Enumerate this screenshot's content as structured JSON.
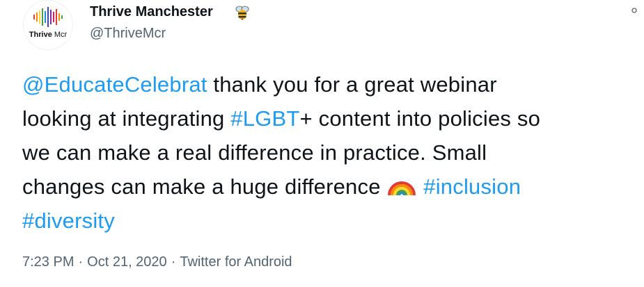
{
  "account": {
    "avatar_logo_text_bold": "Thrive",
    "avatar_logo_text_thin": "Mcr",
    "display_name": "Thrive Manchester",
    "name_emoji": "bee-icon",
    "handle": "@ThriveMcr"
  },
  "tweet": {
    "line1": {
      "mention": "@EducateCelebrat",
      "text": " thank you for a great webinar"
    },
    "line2": {
      "text_before": "looking at integrating ",
      "hashtag": "#LGBT",
      "text_after": "+ content into policies so"
    },
    "line3": {
      "text": "we  can make a real difference in practice. Small"
    },
    "line4": {
      "text": "changes can make a huge difference ",
      "emoji": "rainbow-icon",
      "hashtag": "#inclusion"
    },
    "line5": {
      "hashtag": "#diversity"
    }
  },
  "meta": {
    "time": "7:23 PM",
    "separator": "·",
    "date": "Oct 21, 2020",
    "source": "Twitter for Android"
  },
  "colors": {
    "link": "#1d9bf0",
    "text": "#0f1419",
    "secondary": "#536471"
  }
}
